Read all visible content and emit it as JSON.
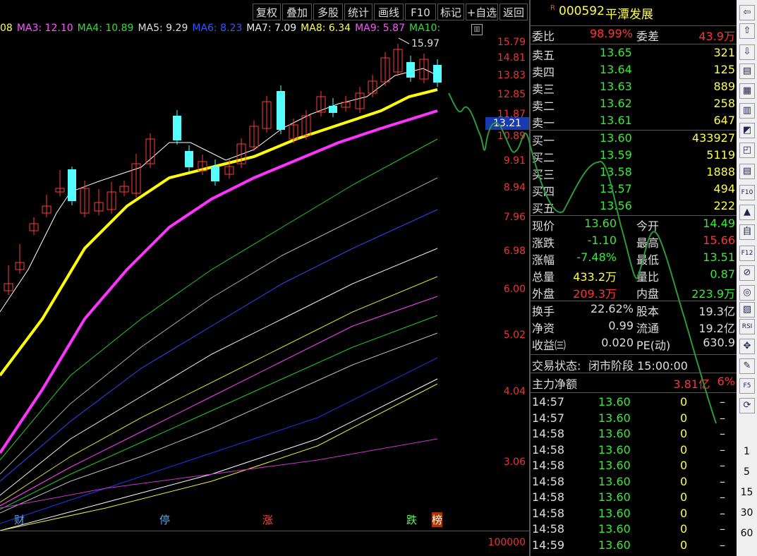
{
  "toolbar": {
    "buttons": [
      "复权",
      "叠加",
      "多股",
      "统计",
      "画线",
      "F10",
      "标记",
      "+自选",
      "返回"
    ]
  },
  "ma_legend": [
    {
      "label": "08",
      "color": "#ffff55"
    },
    {
      "label": "MA3: 12.10",
      "color": "#ff55ff"
    },
    {
      "label": "MA4: 10.89",
      "color": "#33dd33"
    },
    {
      "label": "MA5: 9.29",
      "color": "#dddddd"
    },
    {
      "label": "MA6: 8.23",
      "color": "#3355ff"
    },
    {
      "label": "MA7: 7.09",
      "color": "#eeeeee"
    },
    {
      "label": "MA8: 6.34",
      "color": "#ffff55"
    },
    {
      "label": "MA9: 5.87",
      "color": "#ff55ff"
    },
    {
      "label": "MA10:",
      "color": "#33dd33"
    }
  ],
  "price_axis": {
    "labels": [
      "15.79",
      "14.81",
      "13.83",
      "12.85",
      "11.87",
      "10.89",
      "9.91",
      "8.94",
      "7.96",
      "6.98",
      "6.00",
      "5.02",
      "4.04",
      "3.06"
    ],
    "current_price": "13.21",
    "volume_label": "100000"
  },
  "chart_marks": {
    "high_label": "15.97",
    "tags": [
      {
        "text": "财",
        "color": "#55aaff"
      },
      {
        "text": "停",
        "color": "#55aaff"
      },
      {
        "text": "涨",
        "color": "#ff4444"
      },
      {
        "text": "跌",
        "color": "#55ff55"
      },
      {
        "text": "榜",
        "color": "#ff5555"
      }
    ]
  },
  "stock": {
    "flag": "R",
    "code": "000592",
    "name": "平潭发展"
  },
  "order_book": {
    "weibi_label": "委比",
    "weibi": "98.99%",
    "weicha_label": "委差",
    "weicha": "43.9万",
    "asks": [
      {
        "label": "卖五",
        "price": "13.65",
        "vol": "321"
      },
      {
        "label": "卖四",
        "price": "13.64",
        "vol": "125"
      },
      {
        "label": "卖三",
        "price": "13.63",
        "vol": "889"
      },
      {
        "label": "卖二",
        "price": "13.62",
        "vol": "258"
      },
      {
        "label": "卖一",
        "price": "13.61",
        "vol": "647"
      }
    ],
    "bids": [
      {
        "label": "买一",
        "price": "13.60",
        "vol": "433927"
      },
      {
        "label": "买二",
        "price": "13.59",
        "vol": "5119"
      },
      {
        "label": "买三",
        "price": "13.58",
        "vol": "1888"
      },
      {
        "label": "买四",
        "price": "13.57",
        "vol": "494"
      },
      {
        "label": "买五",
        "price": "13.56",
        "vol": "222"
      }
    ]
  },
  "quote": [
    {
      "l1": "现价",
      "v1": "13.60",
      "c1": "#33ee33",
      "l2": "今开",
      "v2": "14.49",
      "c2": "#33ee33"
    },
    {
      "l1": "涨跌",
      "v1": "-1.10",
      "c1": "#33ee33",
      "l2": "最高",
      "v2": "15.66",
      "c2": "#ff3333"
    },
    {
      "l1": "涨幅",
      "v1": "-7.48%",
      "c1": "#33ee33",
      "l2": "最低",
      "v2": "13.51",
      "c2": "#33ee33"
    },
    {
      "l1": "总量",
      "v1": "433.2万",
      "c1": "#ffff44",
      "l2": "量比",
      "v2": "0.87",
      "c2": "#33ee33"
    },
    {
      "l1": "外盘",
      "v1": "209.3万",
      "c1": "#ff3333",
      "l2": "内盘",
      "v2": "223.9万",
      "c2": "#33ee33"
    }
  ],
  "fundamentals": [
    {
      "l1": "换手",
      "v1": "22.62%",
      "l2": "股本",
      "v2": "19.3亿"
    },
    {
      "l1": "净资",
      "v1": "0.99",
      "l2": "流通",
      "v2": "19.2亿"
    },
    {
      "l1": "收益㈢",
      "v1": "0.020",
      "l2": "PE(动)",
      "v2": "630.9"
    }
  ],
  "status": {
    "label": "交易状态:",
    "value": "闭市阶段 15:00:00"
  },
  "main_flow": {
    "label": "主力净额",
    "value": "3.81亿",
    "pct": "6%"
  },
  "ticks": [
    {
      "time": "14:57",
      "price": "13.60",
      "vol": "0",
      "dir": "–"
    },
    {
      "time": "14:57",
      "price": "13.60",
      "vol": "0",
      "dir": "–"
    },
    {
      "time": "14:58",
      "price": "13.60",
      "vol": "0",
      "dir": "–"
    },
    {
      "time": "14:58",
      "price": "13.60",
      "vol": "0",
      "dir": "–"
    },
    {
      "time": "14:58",
      "price": "13.60",
      "vol": "0",
      "dir": "–"
    },
    {
      "time": "14:58",
      "price": "13.60",
      "vol": "0",
      "dir": "–"
    },
    {
      "time": "14:58",
      "price": "13.60",
      "vol": "0",
      "dir": "–"
    },
    {
      "time": "14:58",
      "price": "13.60",
      "vol": "0",
      "dir": "–"
    },
    {
      "time": "14:58",
      "price": "13.60",
      "vol": "0",
      "dir": "–"
    },
    {
      "time": "14:59",
      "price": "13.60",
      "vol": "0",
      "dir": "–"
    }
  ],
  "side_tools": [
    "⇦",
    "⇧",
    "⇩",
    "▤",
    "▦",
    "▥",
    "◩",
    "◰",
    "▤",
    "F10",
    "▲",
    "自",
    "F12",
    "⊘",
    "◎",
    "▨",
    "RSI",
    "✥",
    "✎",
    "F5",
    "⟳"
  ],
  "periods": [
    "1",
    "5",
    "15",
    "30",
    "60"
  ]
}
